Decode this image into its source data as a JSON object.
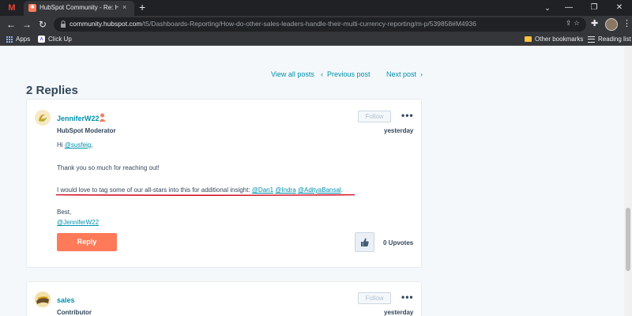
{
  "browser": {
    "gmail_glyph": "M",
    "tab_title": "HubSpot Community - Re: How d",
    "tab_close": "×",
    "new_tab": "+",
    "url_host": "community.hubspot.com",
    "url_path": "/t5/Dashboards-Reporting/How-do-other-sales-leaders-handle-their-multi-currency-reporting/m-p/539858#M4936",
    "bookmarks": [
      {
        "label": "Apps",
        "icon": "apps-grid-icon"
      },
      {
        "label": "Click Up",
        "icon": "clickup-icon"
      }
    ],
    "other_bookmarks": "Other bookmarks",
    "reading_list": "Reading list"
  },
  "post_nav": {
    "view_all": "View all posts",
    "previous": "Previous post",
    "next": "Next post",
    "prev_arrow": "‹",
    "next_arrow": "›"
  },
  "replies_title": "2 Replies",
  "replies": [
    {
      "username": "JenniferW22",
      "role": "HubSpot Moderator",
      "follow_label": "Follow",
      "more": "•••",
      "date": "yesterday",
      "greeting_prefix": "Hi ",
      "greeting_mention": "@susfeig",
      "greeting_suffix": ",",
      "line1": "Thank you so much for reaching out!",
      "line2_prefix": "I would love to tag some of our all-stars into this for additional insight: ",
      "mentions": [
        "@Dan1",
        "@Indra",
        "@AdityaBansal"
      ],
      "line2_suffix": ".",
      "signoff": "Best,",
      "signature": "@JenniferW22",
      "reply_label": "Reply",
      "upvotes": "0 Upvotes"
    },
    {
      "username": "sales",
      "role": "Contributor",
      "follow_label": "Follow",
      "more": "•••",
      "date": "yesterday"
    }
  ],
  "colors": {
    "accent": "#0091ae",
    "reply_button": "#ff7a59",
    "annotation": "#d0021b"
  }
}
